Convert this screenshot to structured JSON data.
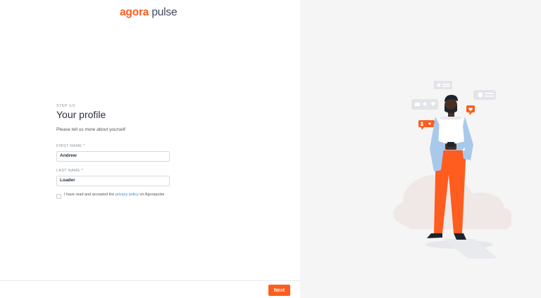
{
  "logo": {
    "agora": "agora",
    "pulse": "pulse"
  },
  "form": {
    "step": "STEP 1/3",
    "title": "Your profile",
    "subtitle": "Please tell us more about yourself",
    "first_name_label": "FIRST NAME *",
    "first_name_value": "Andrew",
    "last_name_label": "LAST NAME *",
    "last_name_value": "Loader",
    "consent_prefix": "I have read and accepted the ",
    "consent_link": "privacy policy",
    "consent_suffix": " on Agorapulse",
    "consent_checked": false
  },
  "footer": {
    "next_label": "Next"
  },
  "colors": {
    "accent": "#ff5c1f",
    "link": "#2f8bd6",
    "panel_bg": "#f5f5f6"
  },
  "illustration": {
    "subject": "person-with-phone-illustration"
  }
}
